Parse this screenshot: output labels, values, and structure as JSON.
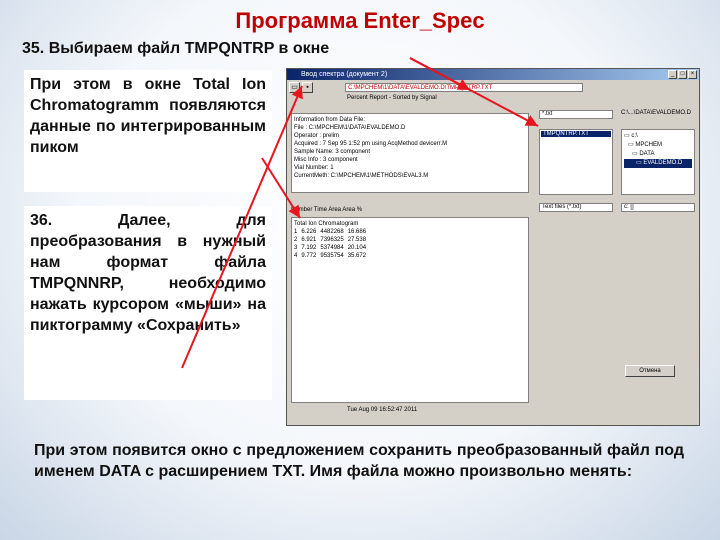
{
  "title": "Программа Enter_Spec",
  "step35": "35. Выбираем файл TMPQNTRP в окне",
  "panel1": "При этом в окне Total Ion Chromatogramm появляются данные по интегрированным пиком",
  "panel2": "36. Далее, для преобразования в нужный нам формат файла TMPQNNRP, необходимо нажать курсором «мыши» на пиктограмму «Сохранить»",
  "bottom_text": "При этом появится окно с предложением сохранить преобразованный файл под именем DATA с расширением TXT. Имя файла можно произвольно менять:",
  "window": {
    "title": "Ввод спектра (документ 2)",
    "path": "C:\\MPCHEM\\1\\DATA\\EVALDEMO.D\\TMPQNTRP.TXT",
    "subbar": "Percent Report - Sorted by Signal",
    "info_lines": [
      "Information from Data File:",
      "File    : C:\\MPCHEM\\1\\DATA\\EVALDEMO.D",
      "Operator : prelim",
      "Acquired : 7 Sep 95  1:52 pm using AcqMethod devicerr.M",
      "Sample Name: 3 component",
      "Misc Info : 3 component",
      "Vial Number: 1",
      "CurrentMeth: C:\\MPCHEM\\1\\METHODS\\EVAL3.M"
    ],
    "file_filter": "*.txt",
    "file_selected": "TMPQNTRP.TXT",
    "dir_path": "C:\\...\\DATA\\EVALDEMO.D",
    "dirs": [
      "c:\\",
      "MPCHEM",
      "DATA",
      "EVALDEMO.D"
    ],
    "col_header": "Number  Time  Area  Area %",
    "type_filter": "Text files (*.txt)",
    "drive": "c: []",
    "data_title": "Total Ion Chromatogram",
    "rows": [
      [
        "1",
        "6.226",
        "4482268",
        "16.686"
      ],
      [
        "2",
        "6.921",
        "7396325",
        "27.538"
      ],
      [
        "3",
        "7.192",
        "5374984",
        "20.104"
      ],
      [
        "4",
        "9.772",
        "9535754",
        "35.672"
      ]
    ],
    "cancel_label": "Отмена",
    "status": "Tue Aug 09 16:52:47 2011"
  }
}
